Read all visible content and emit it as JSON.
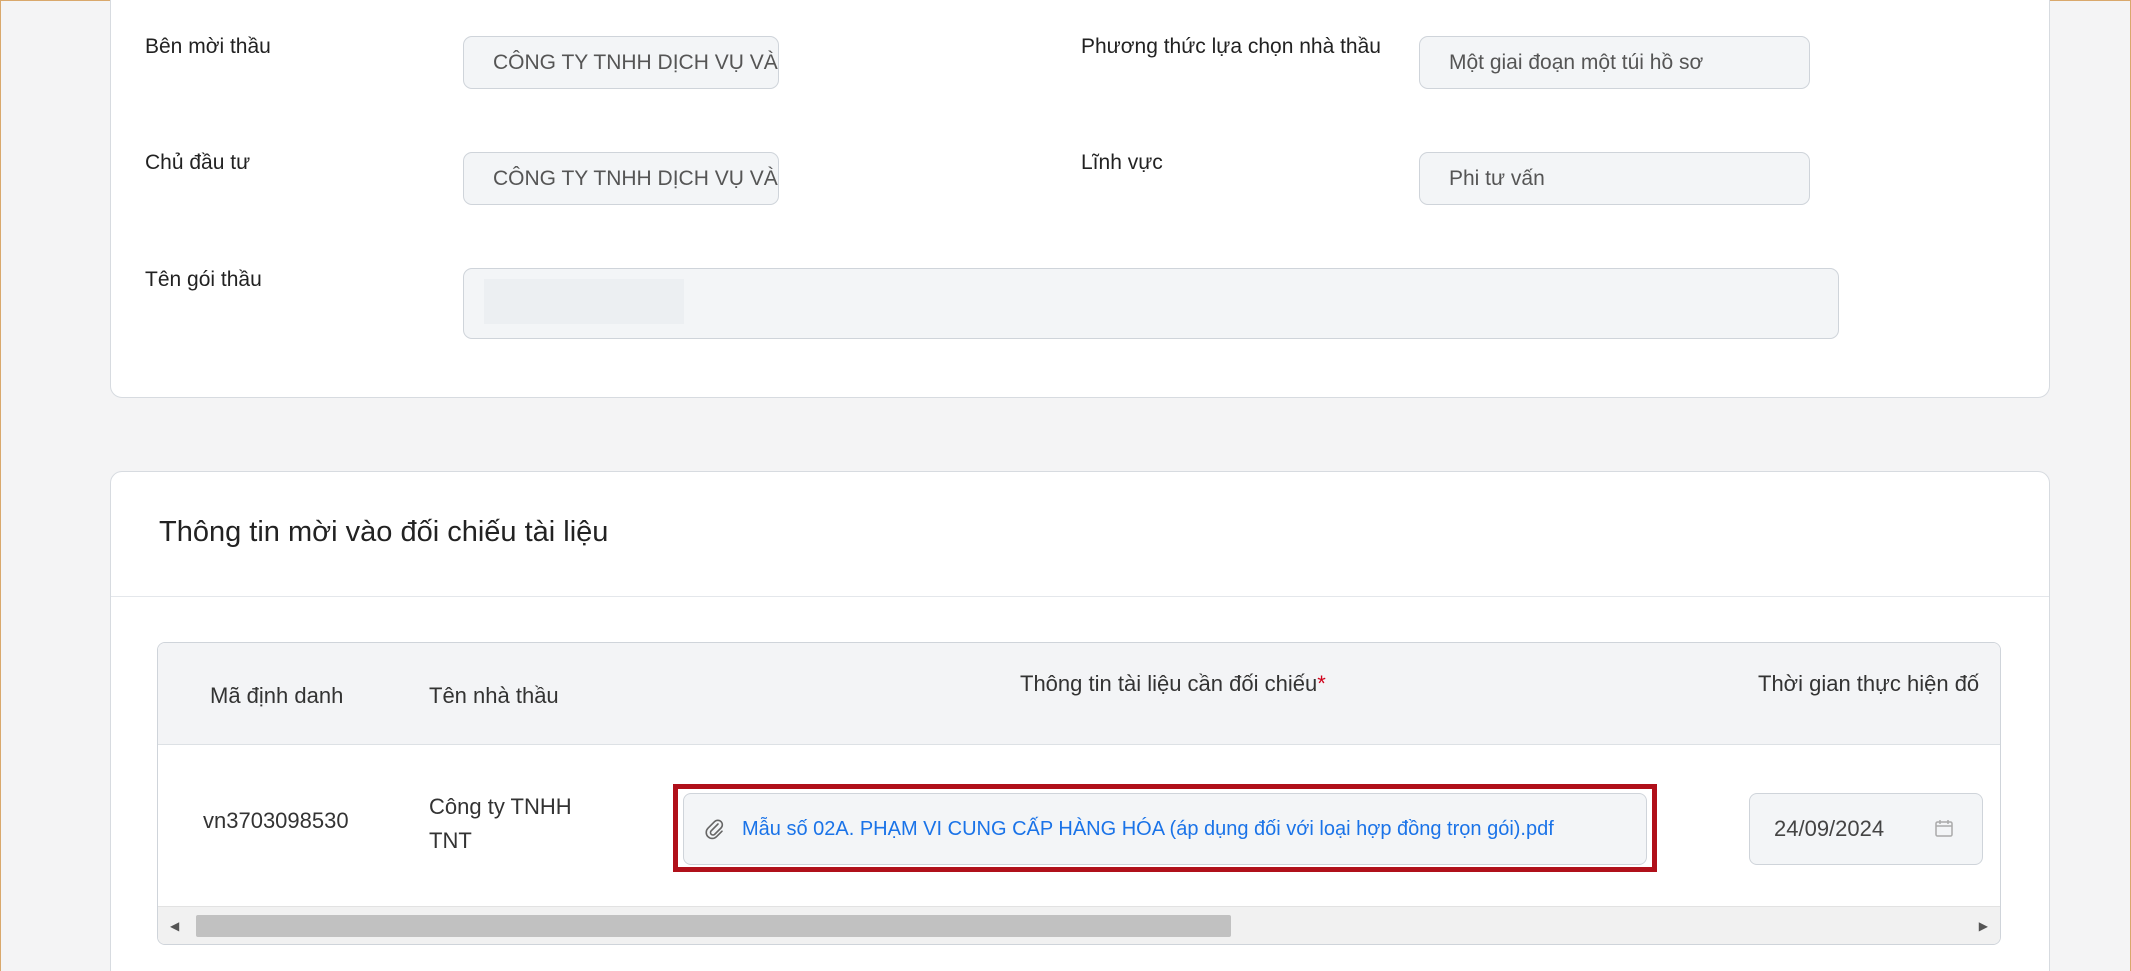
{
  "package_info": {
    "ben_moi_thau": {
      "label": "Bên mời thầu",
      "value": "CÔNG TY TNHH DỊCH VỤ VÀ XÂY"
    },
    "chu_dau_tu": {
      "label": "Chủ đầu tư",
      "value": "CÔNG TY TNHH DỊCH VỤ VÀ XÂY"
    },
    "ten_goi_thau": {
      "label": "Tên gói thầu",
      "value": ""
    },
    "phuong_thuc": {
      "label": "Phương thức lựa chọn nhà thầu",
      "value": "Một giai đoạn một túi hồ sơ"
    },
    "linh_vuc": {
      "label": "Lĩnh vực",
      "value": "Phi tư vấn"
    }
  },
  "invitation": {
    "title": "Thông tin mời vào đối chiếu tài liệu",
    "columns": {
      "ma_dinh_danh": "Mã định danh",
      "ten_nha_thau": "Tên nhà thầu",
      "tai_lieu": "Thông tin tài liệu cần đối chiếu",
      "required_mark": "*",
      "thoi_gian": "Thời gian thực hiện đố"
    },
    "rows": [
      {
        "ma_dinh_danh": "vn3703098530",
        "ten_nha_thau_line1": "Công ty TNHH",
        "ten_nha_thau_line2": "TNT",
        "file_name": "Mẫu số 02A. PHẠM VI CUNG CẤP HÀNG HÓA (áp dụng đối với loại hợp đồng trọn gói).pdf",
        "date": "24/09/2024"
      }
    ]
  },
  "icons": {
    "attachment": "paperclip-icon",
    "date": "calendar-icon"
  },
  "colors": {
    "link": "#1a73e8",
    "highlight": "#b0101a",
    "required": "#d0021b"
  }
}
